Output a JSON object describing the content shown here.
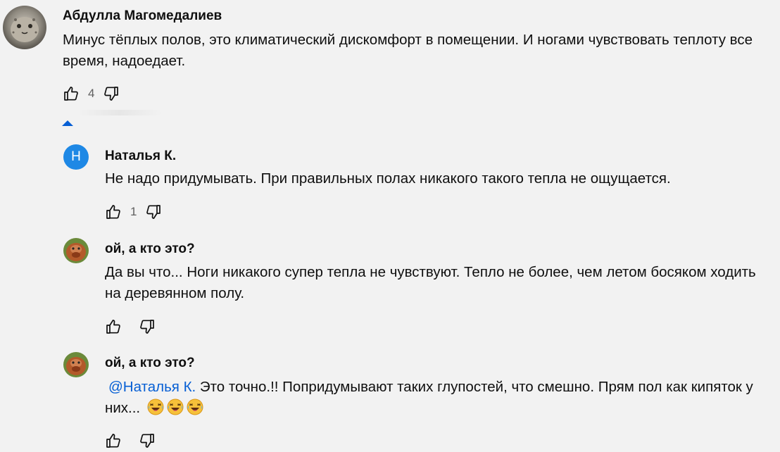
{
  "main_comment": {
    "author": "Абдулла Магомедалиев",
    "text": "Минус тёплых полов, это климатический дискомфорт в помещении. И ногами чувствовать теплоту все время, надоедает.",
    "likes": "4"
  },
  "replies": [
    {
      "author": "Наталья К.",
      "avatar_letter": "Н",
      "avatar_color": "#1e88e5",
      "text": "Не надо придумывать. При правильных полах никакого такого тепла не ощущается.",
      "likes": "1"
    },
    {
      "author": "ой, а кто это?",
      "text": "Да вы что... Ноги никакого супер тепла не чувствуют. Тепло  не более, чем летом босяком ходить на деревянном полу."
    },
    {
      "author": "ой, а кто это?",
      "mention": "@Наталья К.",
      "text": " Это точно.!! Попридумывают таких глупостей, что смешно. Прям пол как кипяток у них... "
    }
  ],
  "icons": {
    "like": "thumb-up-icon",
    "dislike": "thumb-down-icon",
    "collapse": "caret-up-icon",
    "emoji": "laughing-face-emoji"
  },
  "colors": {
    "background": "#f2f2f2",
    "link": "#065fd4",
    "count": "#606060"
  }
}
